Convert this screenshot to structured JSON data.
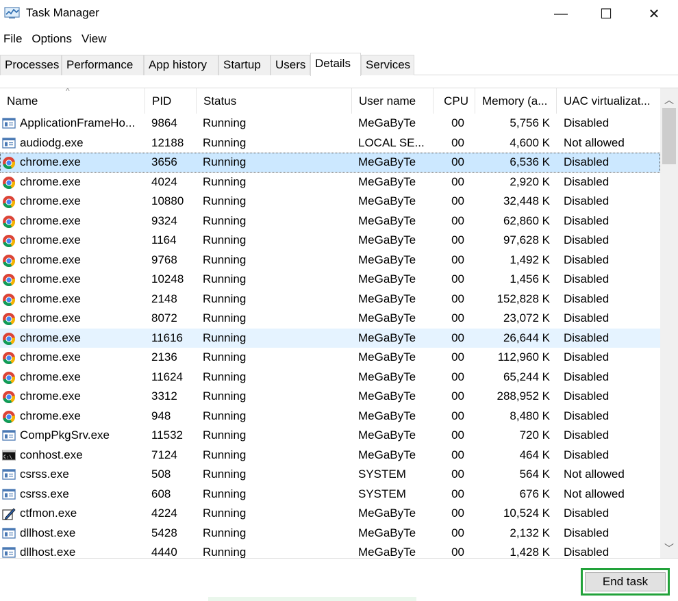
{
  "window": {
    "title": "Task Manager",
    "minimize": "—",
    "maximize": "☐",
    "close": "✕"
  },
  "menu": [
    "File",
    "Options",
    "View"
  ],
  "tabs": [
    {
      "label": "Processes",
      "active": false
    },
    {
      "label": "Performance",
      "active": false
    },
    {
      "label": "App history",
      "active": false
    },
    {
      "label": "Startup",
      "active": false
    },
    {
      "label": "Users",
      "active": false
    },
    {
      "label": "Details",
      "active": true
    },
    {
      "label": "Services",
      "active": false
    }
  ],
  "columns": [
    "Name",
    "PID",
    "Status",
    "User name",
    "CPU",
    "Memory (a...",
    "UAC virtualizat..."
  ],
  "sort_indicator": "^",
  "rows": [
    {
      "name": "ApplicationFrameHo...",
      "pid": "9864",
      "status": "Running",
      "user": "MeGaByTe",
      "cpu": "00",
      "mem": "5,756 K",
      "uac": "Disabled",
      "icon": "app-window-icon"
    },
    {
      "name": "audiodg.exe",
      "pid": "12188",
      "status": "Running",
      "user": "LOCAL SE...",
      "cpu": "00",
      "mem": "4,600 K",
      "uac": "Not allowed",
      "icon": "app-window-icon"
    },
    {
      "name": "chrome.exe",
      "pid": "3656",
      "status": "Running",
      "user": "MeGaByTe",
      "cpu": "00",
      "mem": "6,536 K",
      "uac": "Disabled",
      "icon": "chrome-icon",
      "state": "selected"
    },
    {
      "name": "chrome.exe",
      "pid": "4024",
      "status": "Running",
      "user": "MeGaByTe",
      "cpu": "00",
      "mem": "2,920 K",
      "uac": "Disabled",
      "icon": "chrome-icon"
    },
    {
      "name": "chrome.exe",
      "pid": "10880",
      "status": "Running",
      "user": "MeGaByTe",
      "cpu": "00",
      "mem": "32,448 K",
      "uac": "Disabled",
      "icon": "chrome-icon"
    },
    {
      "name": "chrome.exe",
      "pid": "9324",
      "status": "Running",
      "user": "MeGaByTe",
      "cpu": "00",
      "mem": "62,860 K",
      "uac": "Disabled",
      "icon": "chrome-icon"
    },
    {
      "name": "chrome.exe",
      "pid": "1164",
      "status": "Running",
      "user": "MeGaByTe",
      "cpu": "00",
      "mem": "97,628 K",
      "uac": "Disabled",
      "icon": "chrome-icon"
    },
    {
      "name": "chrome.exe",
      "pid": "9768",
      "status": "Running",
      "user": "MeGaByTe",
      "cpu": "00",
      "mem": "1,492 K",
      "uac": "Disabled",
      "icon": "chrome-icon"
    },
    {
      "name": "chrome.exe",
      "pid": "10248",
      "status": "Running",
      "user": "MeGaByTe",
      "cpu": "00",
      "mem": "1,456 K",
      "uac": "Disabled",
      "icon": "chrome-icon"
    },
    {
      "name": "chrome.exe",
      "pid": "2148",
      "status": "Running",
      "user": "MeGaByTe",
      "cpu": "00",
      "mem": "152,828 K",
      "uac": "Disabled",
      "icon": "chrome-icon"
    },
    {
      "name": "chrome.exe",
      "pid": "8072",
      "status": "Running",
      "user": "MeGaByTe",
      "cpu": "00",
      "mem": "23,072 K",
      "uac": "Disabled",
      "icon": "chrome-icon"
    },
    {
      "name": "chrome.exe",
      "pid": "11616",
      "status": "Running",
      "user": "MeGaByTe",
      "cpu": "00",
      "mem": "26,644 K",
      "uac": "Disabled",
      "icon": "chrome-icon",
      "state": "hover"
    },
    {
      "name": "chrome.exe",
      "pid": "2136",
      "status": "Running",
      "user": "MeGaByTe",
      "cpu": "00",
      "mem": "112,960 K",
      "uac": "Disabled",
      "icon": "chrome-icon"
    },
    {
      "name": "chrome.exe",
      "pid": "11624",
      "status": "Running",
      "user": "MeGaByTe",
      "cpu": "00",
      "mem": "65,244 K",
      "uac": "Disabled",
      "icon": "chrome-icon"
    },
    {
      "name": "chrome.exe",
      "pid": "3312",
      "status": "Running",
      "user": "MeGaByTe",
      "cpu": "00",
      "mem": "288,952 K",
      "uac": "Disabled",
      "icon": "chrome-icon"
    },
    {
      "name": "chrome.exe",
      "pid": "948",
      "status": "Running",
      "user": "MeGaByTe",
      "cpu": "00",
      "mem": "8,480 K",
      "uac": "Disabled",
      "icon": "chrome-icon"
    },
    {
      "name": "CompPkgSrv.exe",
      "pid": "11532",
      "status": "Running",
      "user": "MeGaByTe",
      "cpu": "00",
      "mem": "720 K",
      "uac": "Disabled",
      "icon": "app-window-icon"
    },
    {
      "name": "conhost.exe",
      "pid": "7124",
      "status": "Running",
      "user": "MeGaByTe",
      "cpu": "00",
      "mem": "464 K",
      "uac": "Disabled",
      "icon": "console-icon"
    },
    {
      "name": "csrss.exe",
      "pid": "508",
      "status": "Running",
      "user": "SYSTEM",
      "cpu": "00",
      "mem": "564 K",
      "uac": "Not allowed",
      "icon": "app-window-icon"
    },
    {
      "name": "csrss.exe",
      "pid": "608",
      "status": "Running",
      "user": "SYSTEM",
      "cpu": "00",
      "mem": "676 K",
      "uac": "Not allowed",
      "icon": "app-window-icon"
    },
    {
      "name": "ctfmon.exe",
      "pid": "4224",
      "status": "Running",
      "user": "MeGaByTe",
      "cpu": "00",
      "mem": "10,524 K",
      "uac": "Disabled",
      "icon": "pen-icon"
    },
    {
      "name": "dllhost.exe",
      "pid": "5428",
      "status": "Running",
      "user": "MeGaByTe",
      "cpu": "00",
      "mem": "2,132 K",
      "uac": "Disabled",
      "icon": "app-window-icon"
    },
    {
      "name": "dllhost.exe",
      "pid": "4440",
      "status": "Running",
      "user": "MeGaByTe",
      "cpu": "00",
      "mem": "1,428 K",
      "uac": "Disabled",
      "icon": "app-window-icon"
    }
  ],
  "footer": {
    "end_task": "End task"
  },
  "colors": {
    "selected_row": "#cce8ff",
    "hover_row": "#e5f3ff",
    "highlight_border": "#22a23a"
  }
}
